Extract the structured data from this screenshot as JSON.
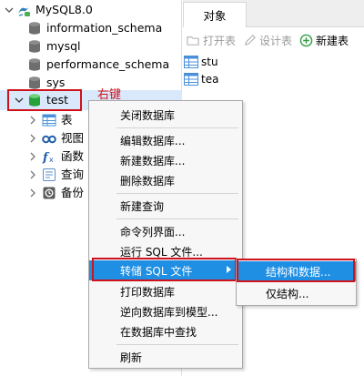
{
  "tree": {
    "connection": "MySQL8.0",
    "databases": [
      "information_schema",
      "mysql",
      "performance_schema",
      "sys"
    ],
    "selected_db": "test",
    "children": [
      {
        "label": "表",
        "icon": "table-icon"
      },
      {
        "label": "视图",
        "icon": "view-icon"
      },
      {
        "label": "函数",
        "icon": "function-icon"
      },
      {
        "label": "查询",
        "icon": "query-icon"
      },
      {
        "label": "备份",
        "icon": "backup-icon"
      }
    ]
  },
  "annotation": {
    "right_click": "右键"
  },
  "panel": {
    "tab": "对象",
    "toolbar": {
      "open_table": "打开表",
      "design_table": "设计表",
      "new_table": "新建表"
    },
    "objects": [
      "stu",
      "tea"
    ]
  },
  "context_menu": {
    "items": [
      "关闭数据库",
      "编辑数据库...",
      "新建数据库...",
      "删除数据库",
      "新建查询",
      "命令列界面...",
      "运行 SQL 文件...",
      "转储 SQL 文件",
      "打印数据库",
      "逆向数据库到模型...",
      "在数据库中查找",
      "刷新"
    ],
    "submenu": [
      "结构和数据...",
      "仅结构..."
    ]
  },
  "colors": {
    "highlight_border": "#d0121b",
    "menu_selection": "#1f8fe4",
    "tree_selection": "#d9e8fb"
  }
}
